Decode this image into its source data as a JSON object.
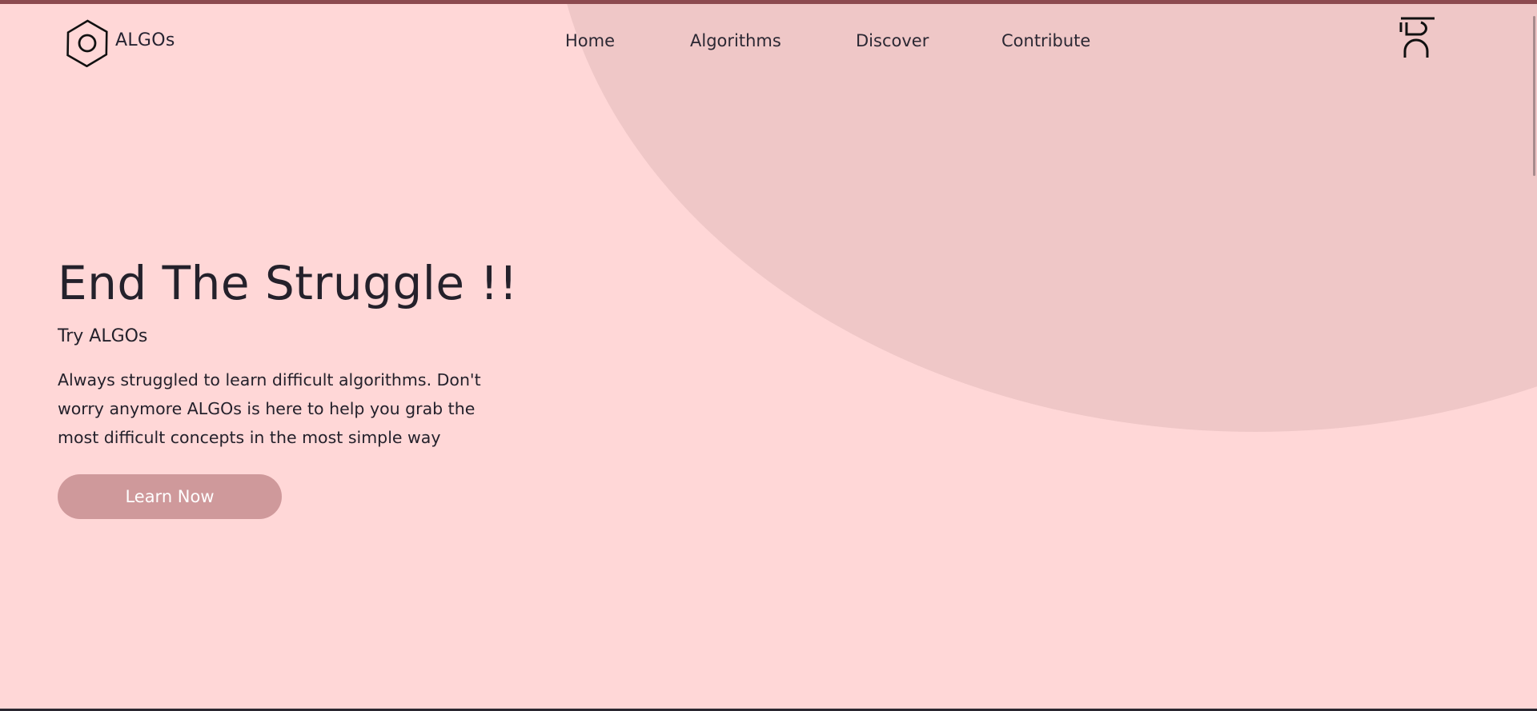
{
  "brand": {
    "name": "ALGOs",
    "logo_icon": "hexagon-logo-icon"
  },
  "nav": {
    "links": [
      {
        "label": "Home"
      },
      {
        "label": "Algorithms"
      },
      {
        "label": "Discover"
      },
      {
        "label": "Contribute"
      }
    ],
    "menu_icon": "menu-toggle-icon"
  },
  "hero": {
    "title": "End The Struggle !!",
    "subtitle": "Try ALGOs",
    "description": "Always struggled to learn difficult algorithms. Don't worry anymore ALGOs is here to help you grab the most difficult concepts in the most simple way",
    "cta_label": "Learn Now"
  },
  "colors": {
    "background": "#ffd7d7",
    "blob": "#efc7c7",
    "button": "#cf999b",
    "text": "#24212b",
    "top_strip": "#8c4a4f"
  }
}
